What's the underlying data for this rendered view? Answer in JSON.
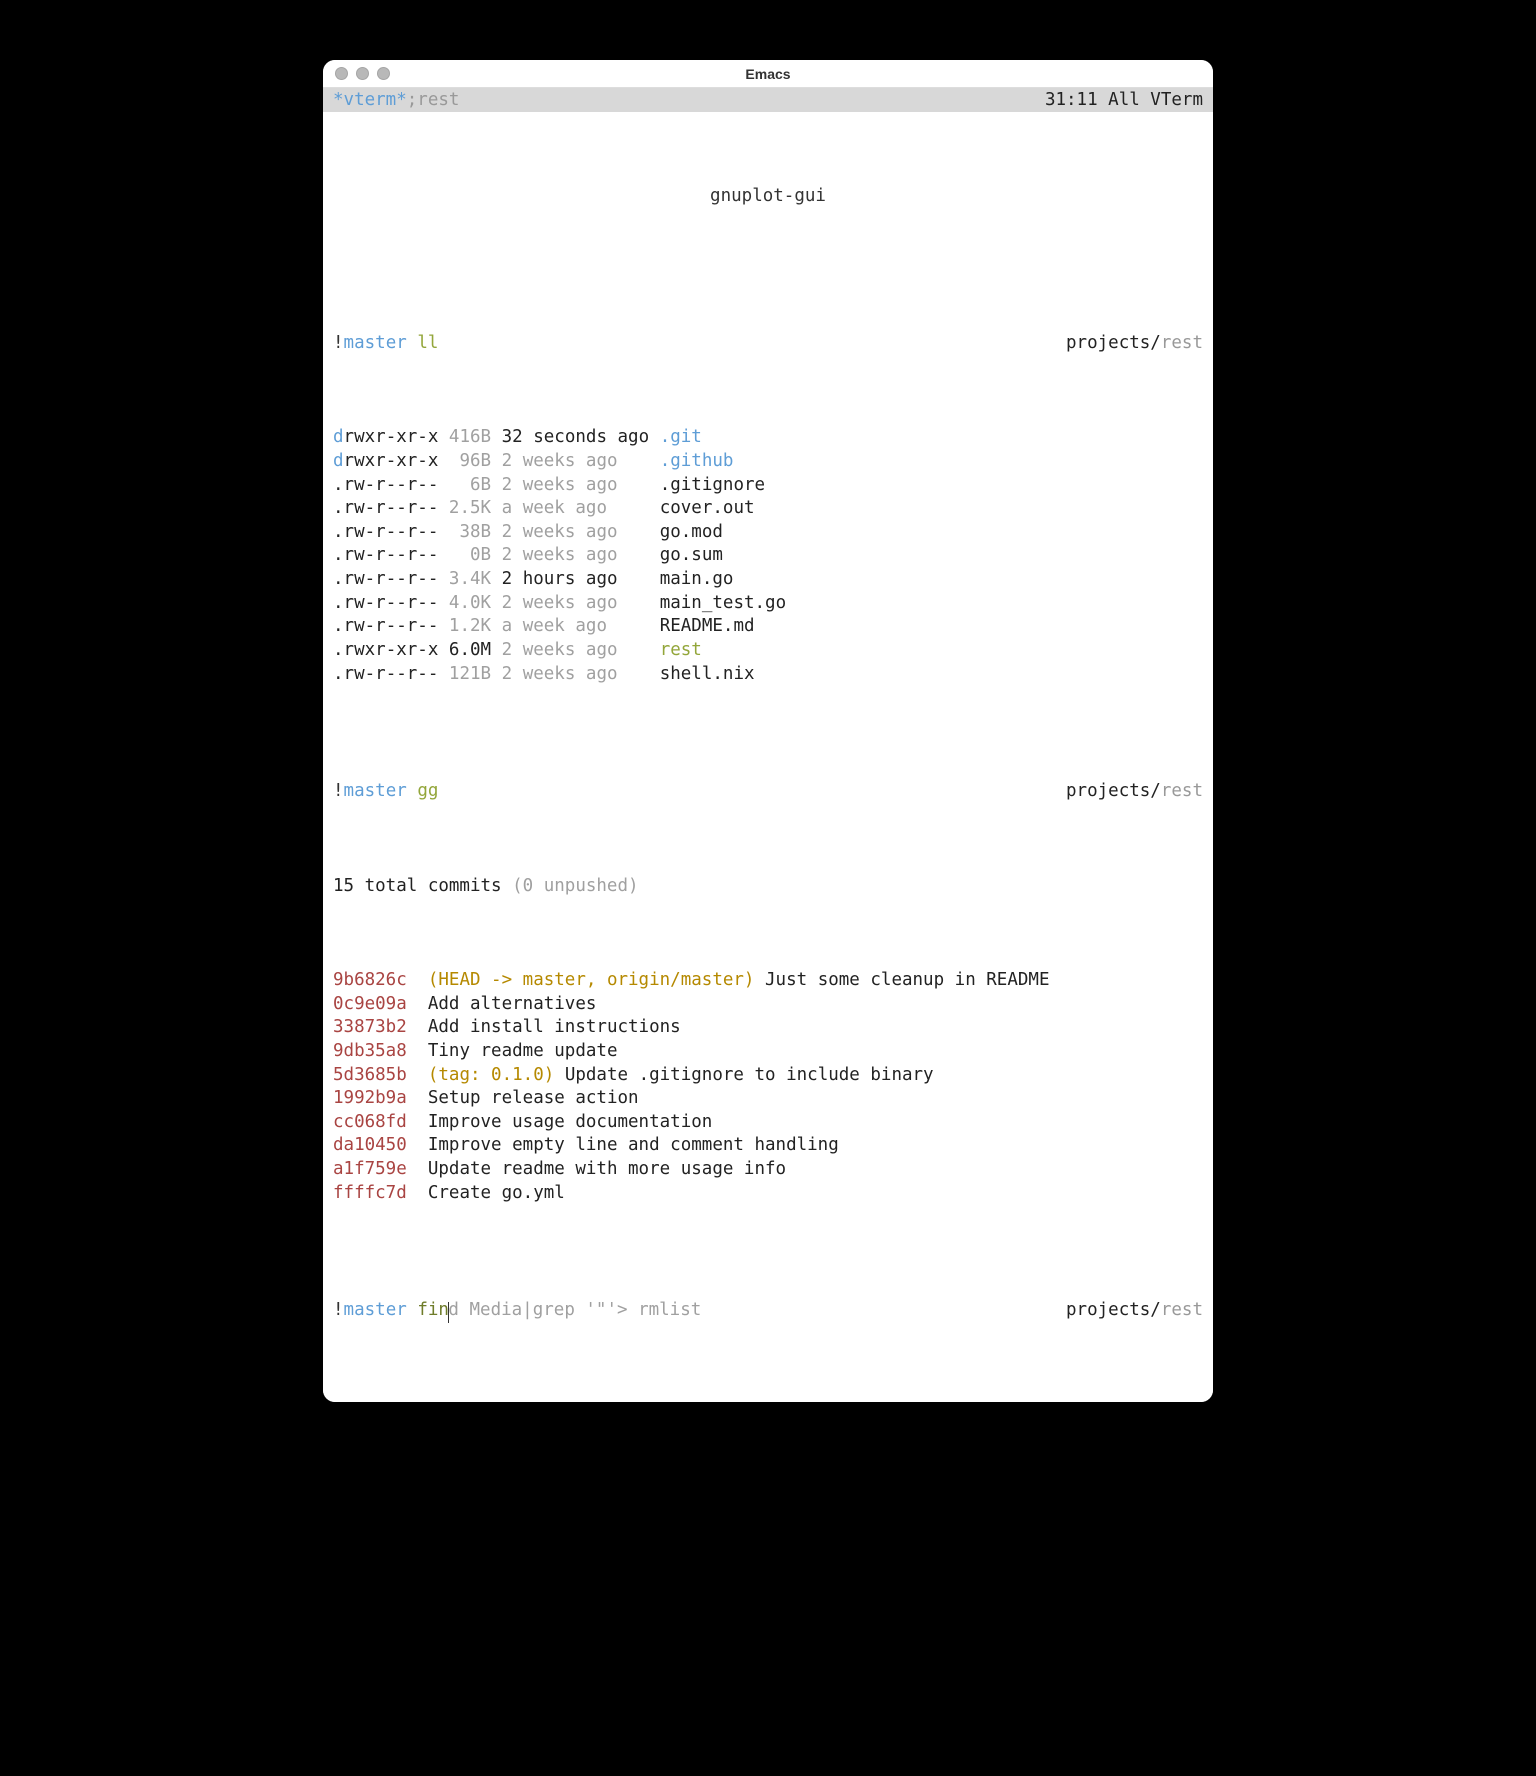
{
  "window": {
    "title": "Emacs"
  },
  "modeline": {
    "buffer": " *vterm*",
    "suffix": "  ;rest",
    "position": "31:11 All VTerm "
  },
  "header_title": "gnuplot-gui",
  "prompt1": {
    "bang": "!",
    "branch": "master",
    "cmd": "ll",
    "path_prefix": "projects/",
    "path_cur": "rest"
  },
  "files": [
    {
      "perm_d": "d",
      "perm_rest": "rwxr-xr-x",
      "size": "416B",
      "date": "32 seconds ago",
      "name": ".git",
      "ncolor": "blue",
      "date_black": true
    },
    {
      "perm_d": "d",
      "perm_rest": "rwxr-xr-x",
      "size": " 96B",
      "date": "2 weeks ago   ",
      "name": ".github",
      "ncolor": "blue"
    },
    {
      "perm_d": ".",
      "perm_rest": "rw-r--r--",
      "size": "  6B",
      "date": "2 weeks ago   ",
      "name": ".gitignore"
    },
    {
      "perm_d": ".",
      "perm_rest": "rw-r--r--",
      "size": "2.5K",
      "date": "a week ago    ",
      "name": "cover.out"
    },
    {
      "perm_d": ".",
      "perm_rest": "rw-r--r--",
      "size": " 38B",
      "date": "2 weeks ago   ",
      "name": "go.mod"
    },
    {
      "perm_d": ".",
      "perm_rest": "rw-r--r--",
      "size": "  0B",
      "date": "2 weeks ago   ",
      "name": "go.sum"
    },
    {
      "perm_d": ".",
      "perm_rest": "rw-r--r--",
      "size": "3.4K",
      "date": "2 hours ago   ",
      "name": "main.go",
      "date_black": true
    },
    {
      "perm_d": ".",
      "perm_rest": "rw-r--r--",
      "size": "4.0K",
      "date": "2 weeks ago   ",
      "name": "main_test.go"
    },
    {
      "perm_d": ".",
      "perm_rest": "rw-r--r--",
      "size": "1.2K",
      "date": "a week ago    ",
      "name": "README.md"
    },
    {
      "perm_d": ".",
      "perm_rest": "rwxr-xr-x",
      "size": "6.0M",
      "date": "2 weeks ago   ",
      "name": "rest",
      "ncolor": "green",
      "size_black": true
    },
    {
      "perm_d": ".",
      "perm_rest": "rw-r--r--",
      "size": "121B",
      "date": "2 weeks ago   ",
      "name": "shell.nix"
    }
  ],
  "prompt2": {
    "bang": "!",
    "branch": "master",
    "cmd": "gg",
    "path_prefix": "projects/",
    "path_cur": "rest"
  },
  "commits_header": {
    "total": "15 total commits",
    "unpushed": " (0 unpushed)"
  },
  "commits": [
    {
      "hash": "9b6826c",
      "refs": "(HEAD -> master, origin/master)",
      "msg": "Just some cleanup in README"
    },
    {
      "hash": "0c9e09a",
      "refs": "",
      "msg": "Add alternatives"
    },
    {
      "hash": "33873b2",
      "refs": "",
      "msg": "Add install instructions"
    },
    {
      "hash": "9db35a8",
      "refs": "",
      "msg": "Tiny readme update"
    },
    {
      "hash": "5d3685b",
      "refs": "(tag: 0.1.0)",
      "msg": "Update .gitignore to include binary"
    },
    {
      "hash": "1992b9a",
      "refs": "",
      "msg": "Setup release action"
    },
    {
      "hash": "cc068fd",
      "refs": "",
      "msg": "Improve usage documentation"
    },
    {
      "hash": "da10450",
      "refs": "",
      "msg": "Improve empty line and comment handling"
    },
    {
      "hash": "a1f759e",
      "refs": "",
      "msg": "Update readme with more usage info"
    },
    {
      "hash": "ffffc7d",
      "refs": "",
      "msg": "Create go.yml"
    }
  ],
  "prompt3": {
    "bang": "!",
    "branch": "master",
    "typed": "fin",
    "suggest": "d Media|grep '\"'> rmlist",
    "path_prefix": "projects/",
    "path_cur": "rest"
  }
}
